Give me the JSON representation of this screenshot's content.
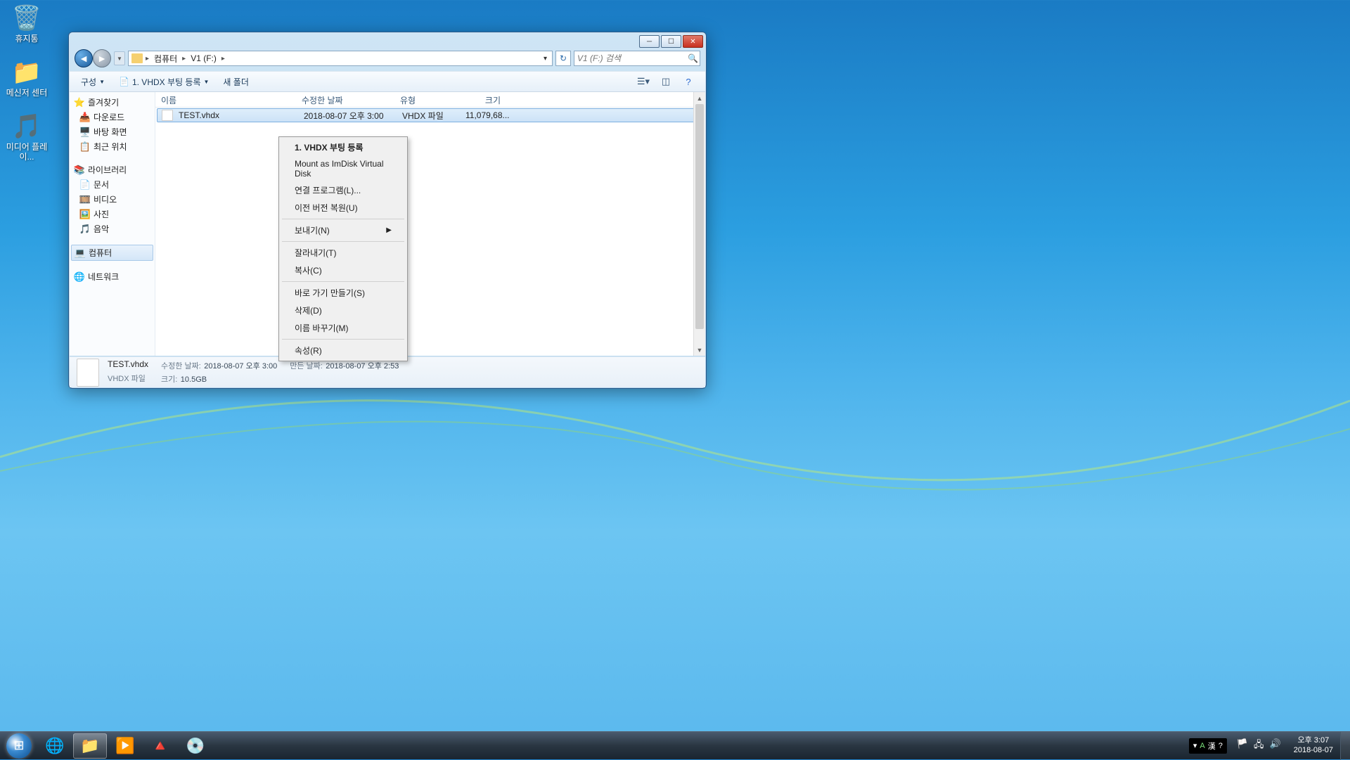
{
  "desktop": {
    "icons": [
      {
        "label": "휴지통",
        "glyph": "🗑️"
      },
      {
        "label": "메신저 센터",
        "glyph": "📁"
      },
      {
        "label": "미디어 플레이...",
        "glyph": "🎵"
      }
    ]
  },
  "window": {
    "breadcrumbs": [
      "컴퓨터",
      "V1 (F:)"
    ],
    "search_placeholder": "V1 (F:) 검색",
    "toolbar": {
      "organize": "구성",
      "action1": "1. VHDX 부팅 등록",
      "new_folder": "새 폴더"
    },
    "sidebar": {
      "favorites": {
        "label": "즐겨찾기",
        "items": [
          "다운로드",
          "바탕 화면",
          "최근 위치"
        ]
      },
      "libraries": {
        "label": "라이브러리",
        "items": [
          "문서",
          "비디오",
          "사진",
          "음악"
        ]
      },
      "computer": {
        "label": "컴퓨터"
      },
      "network": {
        "label": "네트워크"
      }
    },
    "columns": {
      "name": "이름",
      "date": "수정한 날짜",
      "type": "유형",
      "size": "크기"
    },
    "file": {
      "name": "TEST.vhdx",
      "date": "2018-08-07 오후 3:00",
      "type": "VHDX 파일",
      "size": "11,079,68..."
    },
    "details": {
      "name": "TEST.vhdx",
      "subtype": "VHDX 파일",
      "modified_label": "수정한 날짜:",
      "modified_value": "2018-08-07 오후 3:00",
      "created_label": "만든 날짜:",
      "created_value": "2018-08-07 오후 2:53",
      "size_label": "크기:",
      "size_value": "10.5GB"
    }
  },
  "context_menu": {
    "items1": [
      "1. VHDX 부팅 등록",
      "Mount as ImDisk Virtual Disk",
      "연결 프로그램(L)...",
      "이전 버전 복원(U)"
    ],
    "sendto": "보내기(N)",
    "items2": [
      "잘라내기(T)",
      "복사(C)"
    ],
    "items3": [
      "바로 가기 만들기(S)",
      "삭제(D)",
      "이름 바꾸기(M)"
    ],
    "properties": "속성(R)"
  },
  "lang_bar": {
    "ime": "A",
    "han": "漢"
  },
  "clock": {
    "time": "오후 3:07",
    "date": "2018-08-07"
  }
}
